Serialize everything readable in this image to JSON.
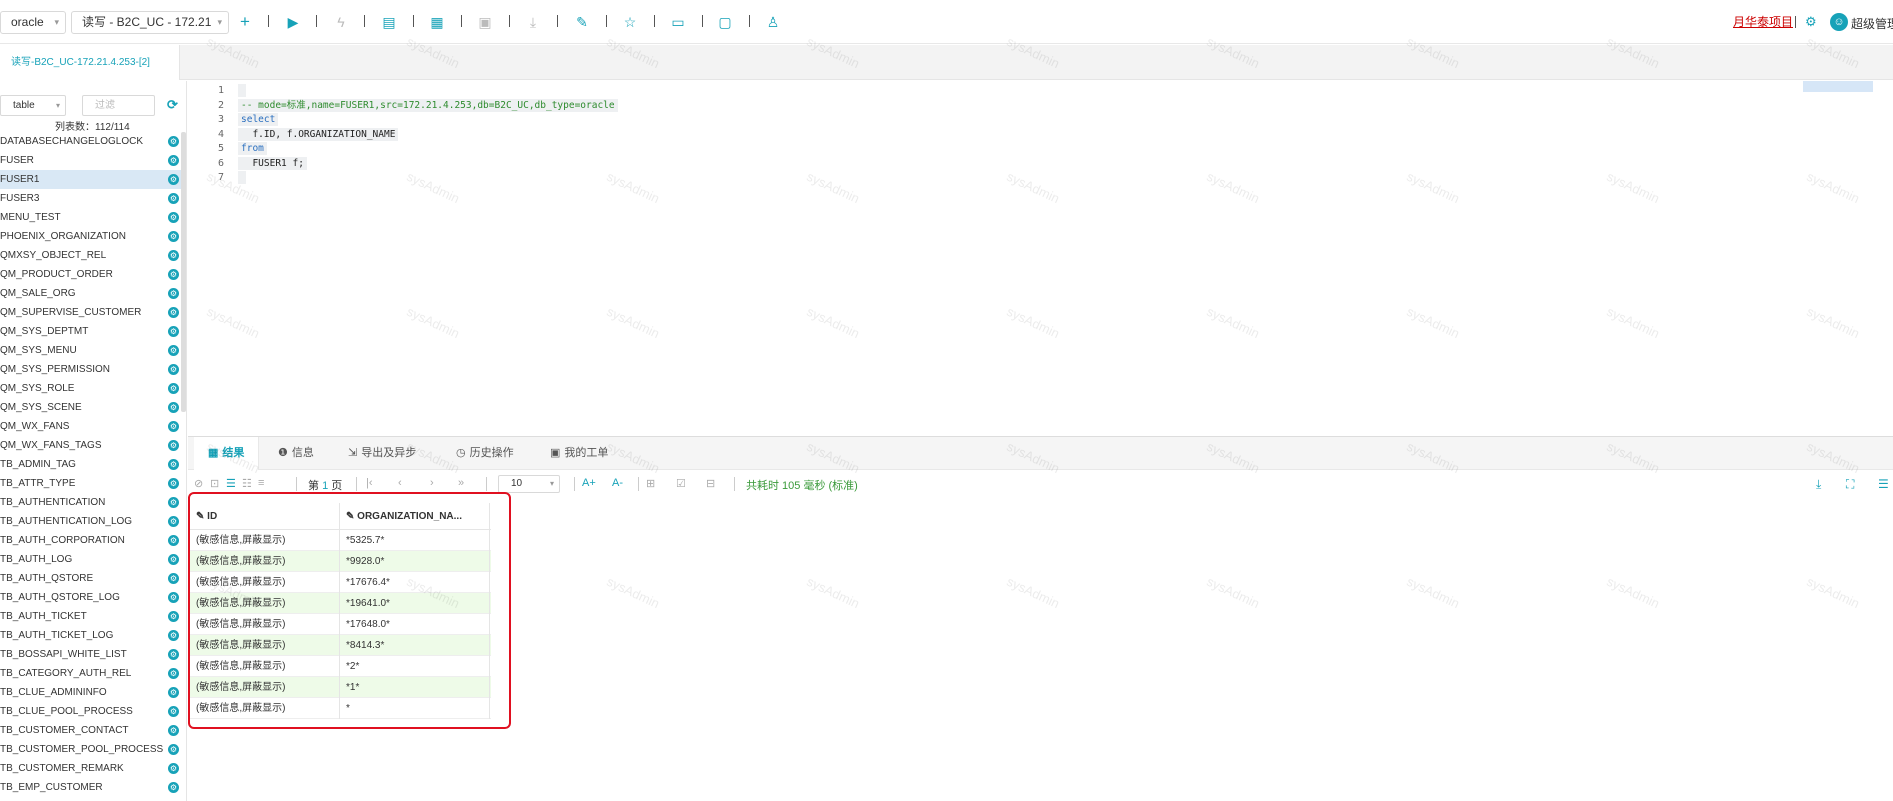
{
  "toolbar": {
    "db_type": "oracle",
    "connection": "读写 - B2C_UC - 172.21",
    "project_link": "月华泰项目",
    "user_name": "超级管理员"
  },
  "tab": {
    "label": "读写-B2C_UC-172.21.4.253-[2]"
  },
  "sidebar": {
    "object_type": "table",
    "filter_placeholder": "过滤",
    "count_label": "列表数：112/114",
    "tables": [
      "DATABASECHANGELOGLOCK",
      "FUSER",
      "FUSER1",
      "FUSER3",
      "MENU_TEST",
      "PHOENIX_ORGANIZATION",
      "QMXSY_OBJECT_REL",
      "QM_PRODUCT_ORDER",
      "QM_SALE_ORG",
      "QM_SUPERVISE_CUSTOMER",
      "QM_SYS_DEPTMT",
      "QM_SYS_MENU",
      "QM_SYS_PERMISSION",
      "QM_SYS_ROLE",
      "QM_SYS_SCENE",
      "QM_WX_FANS",
      "QM_WX_FANS_TAGS",
      "TB_ADMIN_TAG",
      "TB_ATTR_TYPE",
      "TB_AUTHENTICATION",
      "TB_AUTHENTICATION_LOG",
      "TB_AUTH_CORPORATION",
      "TB_AUTH_LOG",
      "TB_AUTH_QSTORE",
      "TB_AUTH_QSTORE_LOG",
      "TB_AUTH_TICKET",
      "TB_AUTH_TICKET_LOG",
      "TB_BOSSAPI_WHITE_LIST",
      "TB_CATEGORY_AUTH_REL",
      "TB_CLUE_ADMININFO",
      "TB_CLUE_POOL_PROCESS",
      "TB_CUSTOMER_CONTACT",
      "TB_CUSTOMER_POOL_PROCESS",
      "TB_CUSTOMER_REMARK",
      "TB_EMP_CUSTOMER"
    ],
    "selected_index": 2
  },
  "editor": {
    "line_numbers": [
      "1",
      "2",
      "3",
      "4",
      "5",
      "6",
      "7"
    ],
    "lines": [
      "",
      "-- mode=标准,name=FUSER1,src=172.21.4.253,db=B2C_UC,db_type=oracle",
      "select",
      "  f.ID, f.ORGANIZATION_NAME",
      "from",
      "  FUSER1 f;",
      ""
    ]
  },
  "bottom": {
    "tabs": [
      "结果",
      "信息",
      "导出及异步",
      "历史操作",
      "我的工单"
    ],
    "page_label_prefix": "第",
    "page_number": "1",
    "page_label_suffix": "页",
    "page_size": "10",
    "time_label": "共耗时 105 毫秒 (标准)"
  },
  "grid": {
    "columns": [
      "ID",
      "ORGANIZATION_NA..."
    ],
    "rows": [
      [
        "(敏感信息,屏蔽显示)",
        "*5325.7*"
      ],
      [
        "(敏感信息,屏蔽显示)",
        "*9928.0*"
      ],
      [
        "(敏感信息,屏蔽显示)",
        "*17676.4*"
      ],
      [
        "(敏感信息,屏蔽显示)",
        "*19641.0*"
      ],
      [
        "(敏感信息,屏蔽显示)",
        "*17648.0*"
      ],
      [
        "(敏感信息,屏蔽显示)",
        "*8414.3*"
      ],
      [
        "(敏感信息,屏蔽显示)",
        "*2*"
      ],
      [
        "(敏感信息,屏蔽显示)",
        "*1*"
      ],
      [
        "(敏感信息,屏蔽显示)",
        "*"
      ]
    ]
  },
  "watermark": "sysAdmin",
  "colors": {
    "accent": "#17a2b8",
    "highlight": "#e01020",
    "row_alt": "#eefbe8"
  }
}
